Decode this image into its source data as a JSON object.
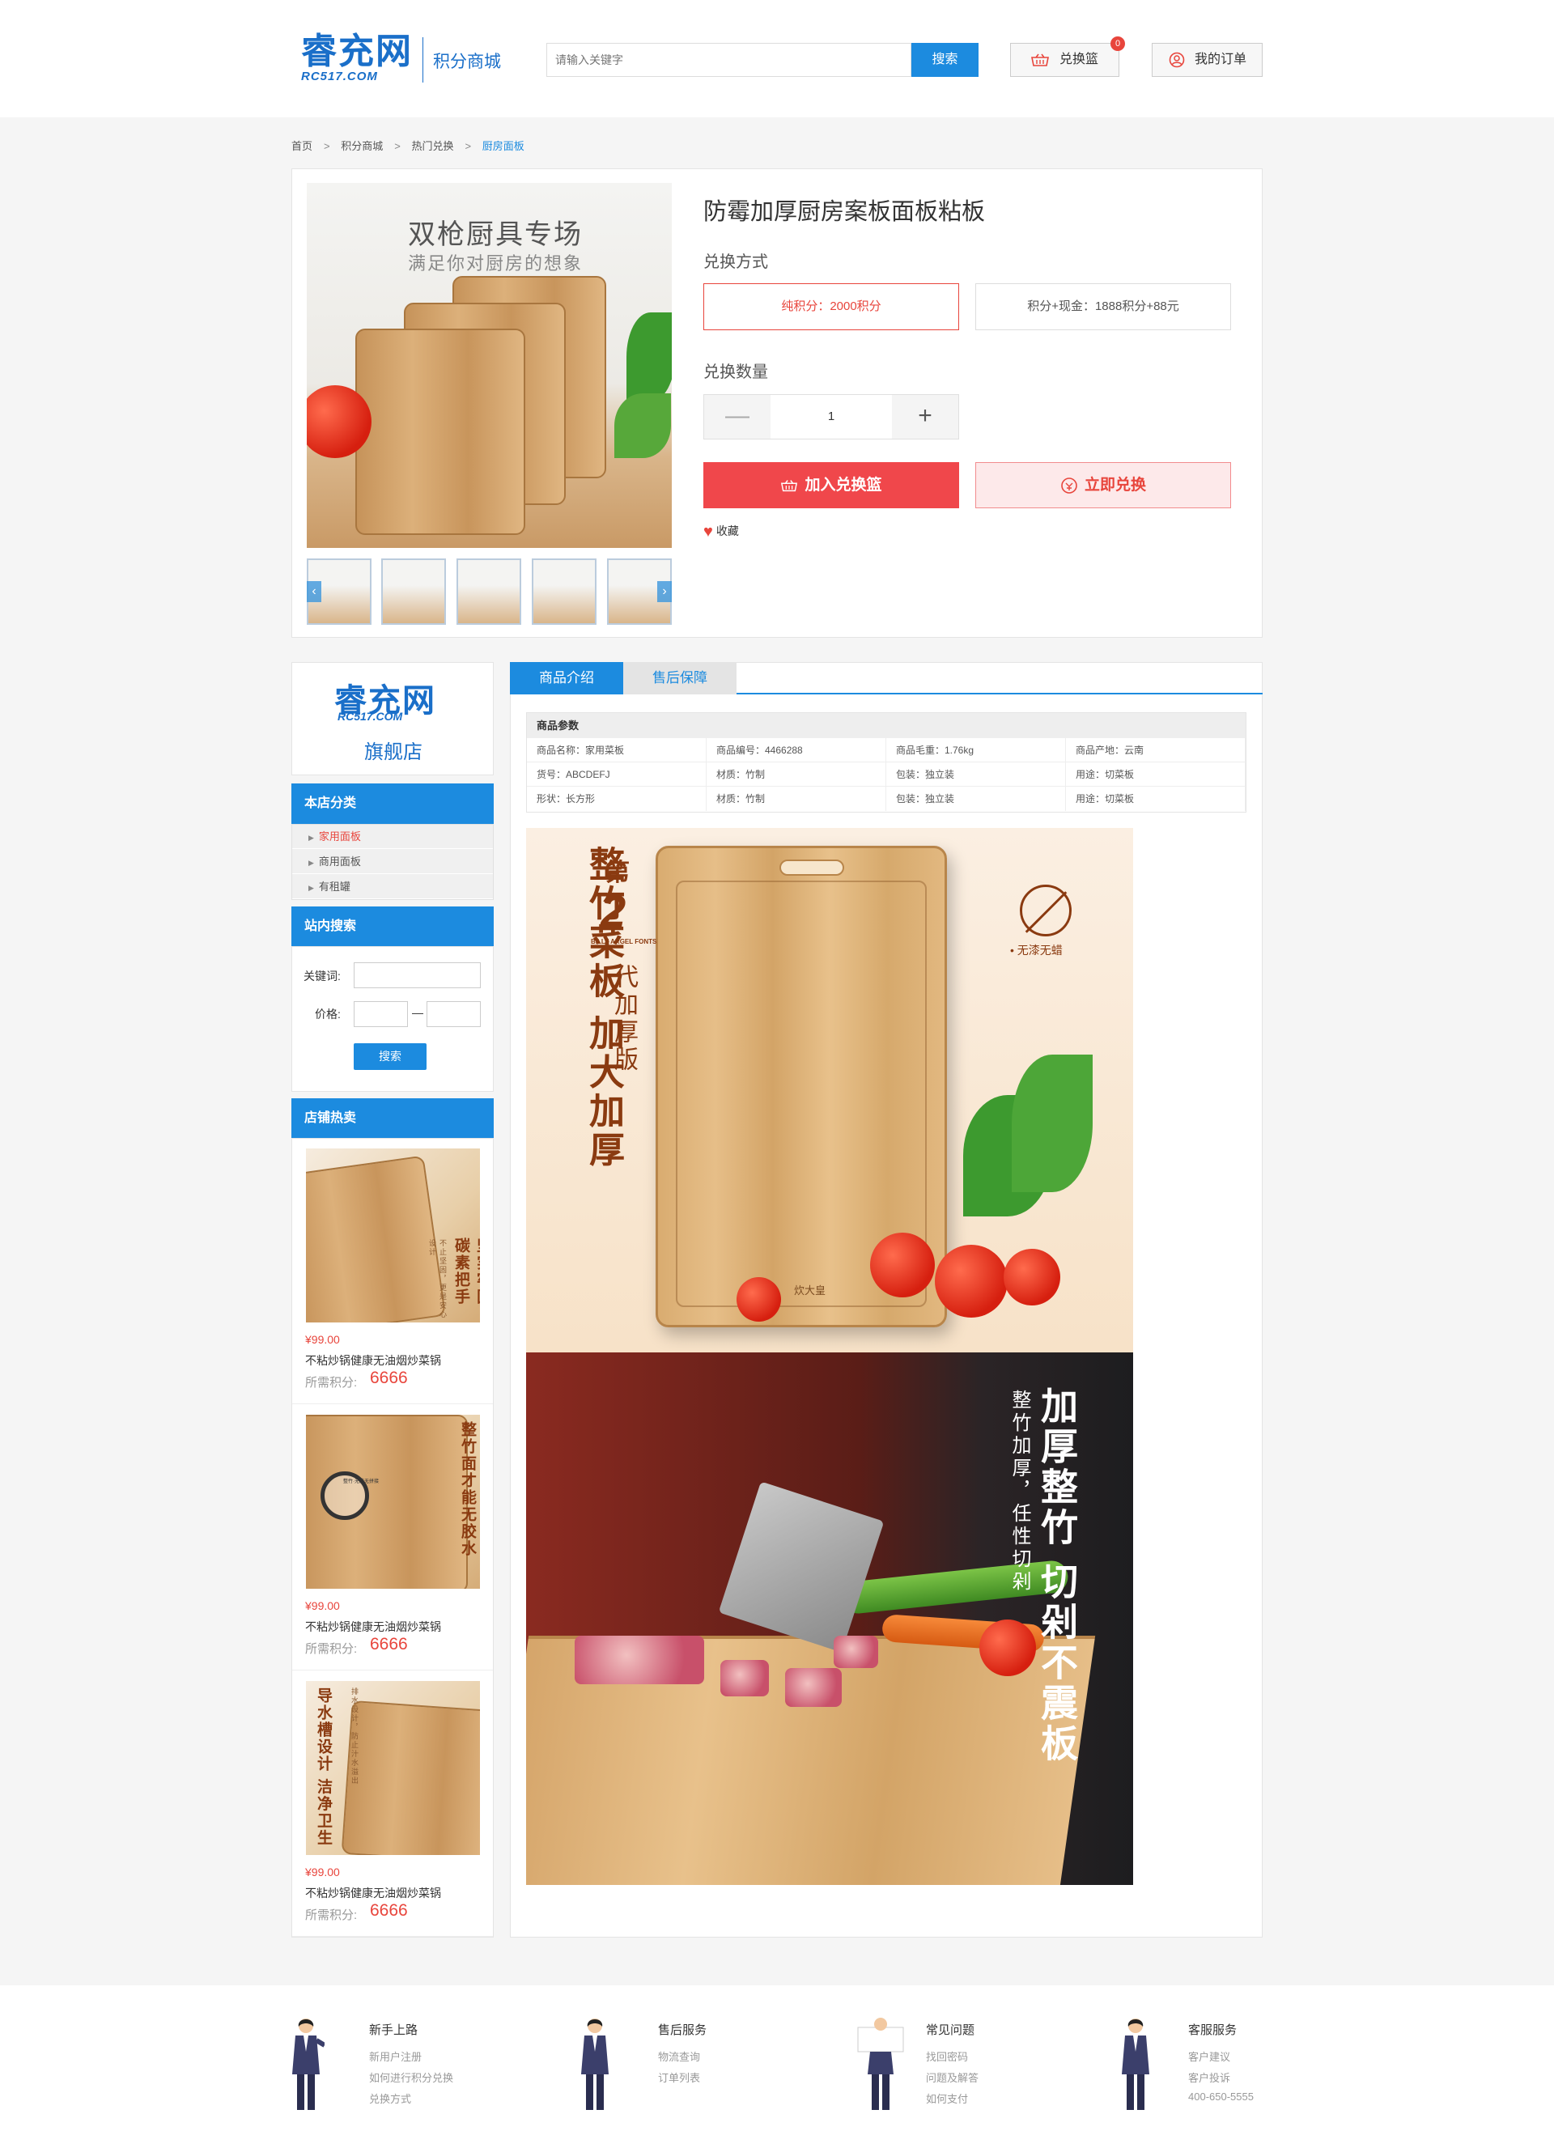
{
  "header": {
    "logo_main": "睿充网",
    "logo_sub": "RC517.COM",
    "mall_name": "积分商城",
    "search_placeholder": "请输入关键字",
    "search_button": "搜索",
    "basket_label": "兑换篮",
    "basket_count": "0",
    "orders_label": "我的订单"
  },
  "breadcrumb": [
    "首页",
    "积分商城",
    "热门兑换",
    "厨房面板"
  ],
  "product": {
    "image_title": "双枪厨具专场",
    "image_subtitle": "满足你对厨房的想象",
    "title": "防霉加厚厨房案板面板粘板",
    "exchange_method_label": "兑换方式",
    "options": [
      "纯积分：2000积分",
      "积分+现金：1888积分+88元"
    ],
    "selected_option": 0,
    "quantity_label": "兑换数量",
    "quantity": "1",
    "minus": "—",
    "plus": "+",
    "add_to_basket": "加入兑换篮",
    "exchange_now": "立即兑换",
    "favorite": "收藏",
    "thumb_prev": "‹",
    "thumb_next": "›"
  },
  "sidebar": {
    "store_logo": "睿充网",
    "store_logo_sub": "RC517.COM",
    "store_flag": "旗舰店",
    "category_title": "本店分类",
    "categories": [
      "家用面板",
      "商用面板",
      "有租罐"
    ],
    "active_category": 0,
    "search_title": "站内搜索",
    "keyword_label": "关键词:",
    "price_label": "价格:",
    "price_dash": "—",
    "search_button": "搜索",
    "hot_title": "店铺热卖",
    "hot_items": [
      {
        "price": "¥99.00",
        "name": "不粘炒锅健康无油烟炒菜锅",
        "points_label": "所需积分:",
        "points": "6666",
        "img_text": "坚实牢固 碳素把手",
        "img_small": "不止坚固，更是安心设计"
      },
      {
        "price": "¥99.00",
        "name": "不粘炒锅健康无油烟炒菜锅",
        "points_label": "所需积分:",
        "points": "6666",
        "img_text": "整竹面才能无胶水",
        "img_small": "整竹·无胶无拼接"
      },
      {
        "price": "¥99.00",
        "name": "不粘炒锅健康无油烟炒菜锅",
        "points_label": "所需积分:",
        "points": "6666",
        "img_text": "导水槽设计 洁净卫生",
        "img_small": "排水设计，防止汁水溢出"
      }
    ]
  },
  "detail": {
    "tabs": [
      "商品介绍",
      "售后保障"
    ],
    "active_tab": 0,
    "params_title": "商品参数",
    "params": [
      [
        "商品名称：家用菜板",
        "商品编号：4466288",
        "商品毛重：1.76kg",
        "商品产地：云南"
      ],
      [
        "货号：ABCDEFJ",
        "材质：竹制",
        "包装：独立装",
        "用途：切菜板"
      ],
      [
        "形状：长方形",
        "材质：竹制",
        "包装：独立装",
        "用途：切菜板"
      ]
    ],
    "img1_left": "整竹菜板 加大加厚",
    "img1_di": "第",
    "img1_num": "2",
    "img1_font": "BILLY ARGEL FONTS",
    "img1_gen": "代加厚版",
    "img1_badge": "• 无漆无蜡",
    "img1_brand": "炊大皇",
    "img2_right": "加厚整竹 切剁不震板",
    "img2_small": "整竹加厚，任性切剁"
  },
  "footer": [
    {
      "title": "新手上路",
      "links": [
        "新用户注册",
        "如何进行积分兑换",
        "兑换方式"
      ]
    },
    {
      "title": "售后服务",
      "links": [
        "物流查询",
        "订单列表"
      ]
    },
    {
      "title": "常见问题",
      "links": [
        "找回密码",
        "问题及解答",
        "如何支付"
      ]
    },
    {
      "title": "客服服务",
      "links": [
        "客户建议",
        "客户投诉",
        "400-650-5555"
      ]
    }
  ],
  "colors": {
    "brand_blue": "#1c8bdf",
    "logo_blue": "#1a6fc9",
    "accent_red": "#e8453c",
    "cart_red": "#f0474b"
  }
}
